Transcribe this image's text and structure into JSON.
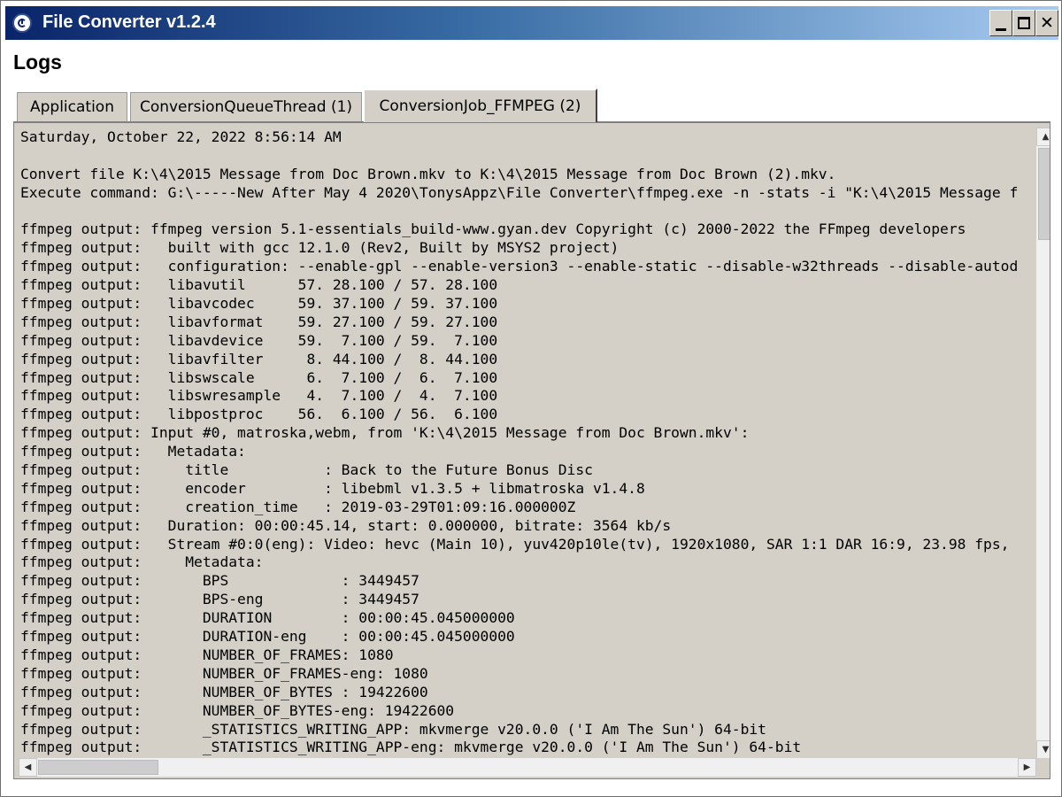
{
  "window": {
    "title": "File Converter v1.2.4",
    "minimize_glyph": "",
    "maximize_glyph": "",
    "close_glyph": "✕"
  },
  "heading": "Logs",
  "tabs": [
    {
      "label": "Application",
      "selected": false
    },
    {
      "label": "ConversionQueueThread (1)",
      "selected": false
    },
    {
      "label": "ConversionJob_FFMPEG (2)",
      "selected": true
    }
  ],
  "log_lines": [
    "Saturday, October 22, 2022 8:56:14 AM",
    "",
    "Convert file K:\\4\\2015 Message from Doc Brown.mkv to K:\\4\\2015 Message from Doc Brown (2).mkv.",
    "Execute command: G:\\-----New After May 4 2020\\TonysAppz\\File Converter\\ffmpeg.exe -n -stats -i \"K:\\4\\2015 Message f",
    "",
    "ffmpeg output: ffmpeg version 5.1-essentials_build-www.gyan.dev Copyright (c) 2000-2022 the FFmpeg developers",
    "ffmpeg output:   built with gcc 12.1.0 (Rev2, Built by MSYS2 project)",
    "ffmpeg output:   configuration: --enable-gpl --enable-version3 --enable-static --disable-w32threads --disable-autod",
    "ffmpeg output:   libavutil      57. 28.100 / 57. 28.100",
    "ffmpeg output:   libavcodec     59. 37.100 / 59. 37.100",
    "ffmpeg output:   libavformat    59. 27.100 / 59. 27.100",
    "ffmpeg output:   libavdevice    59.  7.100 / 59.  7.100",
    "ffmpeg output:   libavfilter     8. 44.100 /  8. 44.100",
    "ffmpeg output:   libswscale      6.  7.100 /  6.  7.100",
    "ffmpeg output:   libswresample   4.  7.100 /  4.  7.100",
    "ffmpeg output:   libpostproc    56.  6.100 / 56.  6.100",
    "ffmpeg output: Input #0, matroska,webm, from 'K:\\4\\2015 Message from Doc Brown.mkv':",
    "ffmpeg output:   Metadata:",
    "ffmpeg output:     title           : Back to the Future Bonus Disc",
    "ffmpeg output:     encoder         : libebml v1.3.5 + libmatroska v1.4.8",
    "ffmpeg output:     creation_time   : 2019-03-29T01:09:16.000000Z",
    "ffmpeg output:   Duration: 00:00:45.14, start: 0.000000, bitrate: 3564 kb/s",
    "ffmpeg output:   Stream #0:0(eng): Video: hevc (Main 10), yuv420p10le(tv), 1920x1080, SAR 1:1 DAR 16:9, 23.98 fps,",
    "ffmpeg output:     Metadata:",
    "ffmpeg output:       BPS             : 3449457",
    "ffmpeg output:       BPS-eng         : 3449457",
    "ffmpeg output:       DURATION        : 00:00:45.045000000",
    "ffmpeg output:       DURATION-eng    : 00:00:45.045000000",
    "ffmpeg output:       NUMBER_OF_FRAMES: 1080",
    "ffmpeg output:       NUMBER_OF_FRAMES-eng: 1080",
    "ffmpeg output:       NUMBER_OF_BYTES : 19422600",
    "ffmpeg output:       NUMBER_OF_BYTES-eng: 19422600",
    "ffmpeg output:       _STATISTICS_WRITING_APP: mkvmerge v20.0.0 ('I Am The Sun') 64-bit",
    "ffmpeg output:       _STATISTICS_WRITING_APP-eng: mkvmerge v20.0.0 ('I Am The Sun') 64-bit"
  ],
  "scrollbars": {
    "vertical": {
      "up_glyph": "▲",
      "down_glyph": "▼"
    },
    "horizontal": {
      "left_glyph": "◀",
      "right_glyph": "▶"
    }
  },
  "colors": {
    "title_gradient_start": "#0a246a",
    "title_gradient_end": "#a6caf0",
    "panel_background": "#d4d0c8"
  }
}
